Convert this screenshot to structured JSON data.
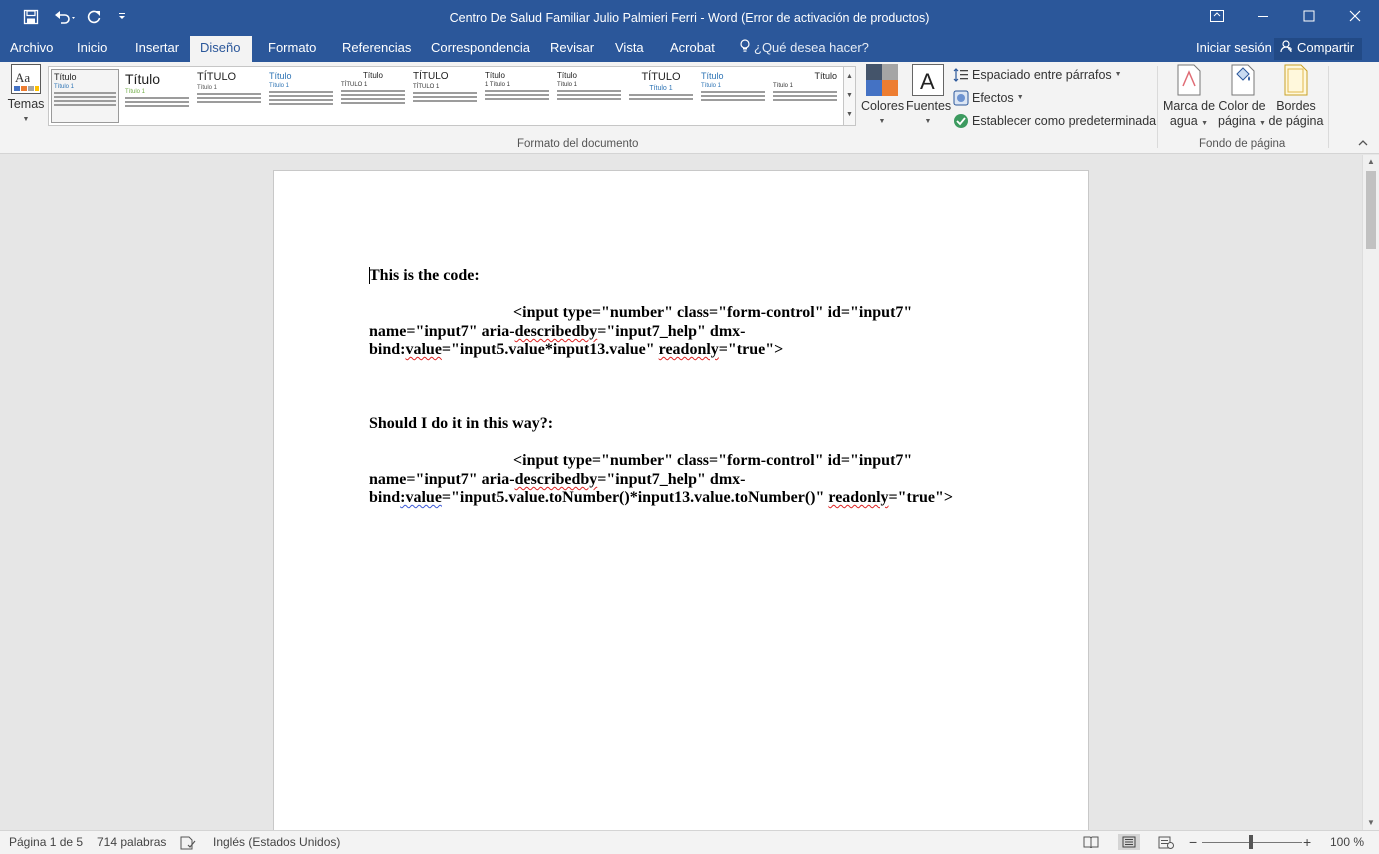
{
  "window": {
    "title": "Centro De Salud Familiar Julio Palmieri Ferri  -  Word (Error de activación de productos)"
  },
  "tabs": [
    {
      "label": "Archivo"
    },
    {
      "label": "Inicio"
    },
    {
      "label": "Insertar"
    },
    {
      "label": "Diseño"
    },
    {
      "label": "Formato"
    },
    {
      "label": "Referencias"
    },
    {
      "label": "Correspondencia"
    },
    {
      "label": "Revisar"
    },
    {
      "label": "Vista"
    },
    {
      "label": "Acrobat"
    }
  ],
  "active_tab": "Diseño",
  "tell_me": "¿Qué desea hacer?",
  "signin": "Iniciar sesión",
  "share": "Compartir",
  "ribbon": {
    "themes": "Temas",
    "styles": [
      {
        "title": "Título",
        "sub": "Título 1"
      },
      {
        "title": "Título",
        "sub": "Título 1"
      },
      {
        "title": "TÍTULO",
        "sub": "Título 1"
      },
      {
        "title": "Título",
        "sub": "Título 1"
      },
      {
        "title": "Título",
        "sub": "TÍTULO 1"
      },
      {
        "title": "TÍTULO",
        "sub": "TÍTULO 1"
      },
      {
        "title": "Título",
        "sub": "1   Título 1"
      },
      {
        "title": "Título",
        "sub": "Título 1"
      },
      {
        "title": "TÍTULO",
        "sub": "Título 1"
      },
      {
        "title": "Título",
        "sub": "Título 1"
      },
      {
        "title": "Título",
        "sub": "Título 1"
      }
    ],
    "colors": "Colores",
    "fonts": "Fuentes",
    "paragraph_spacing": "Espaciado entre párrafos",
    "effects": "Efectos",
    "set_default": "Establecer como predeterminada",
    "doc_format_group": "Formato del documento",
    "watermark_1": "Marca de",
    "watermark_2": "agua",
    "page_color_1": "Color de",
    "page_color_2": "página",
    "page_borders_1": "Bordes",
    "page_borders_2": "de página",
    "page_background_group": "Fondo de página"
  },
  "document": {
    "heading1": "This is the code:",
    "heading2": "Should I do it in this way?:",
    "code1": {
      "l1": "<input type=\"number\" class=\"form-control\" id=\"input7\"",
      "l2a": "name=\"input7\" aria-",
      "l2b": "describedby",
      "l2c": "=\"input7_help\" dmx-",
      "l3a": "bind:",
      "l3b": "value",
      "l3c": "=\"input5.value*input13.value\" ",
      "l3d": "readonly",
      "l3e": "=\"true\">"
    },
    "code2": {
      "l1": "<input type=\"number\" class=\"form-control\" id=\"input7\"",
      "l2a": "name=\"input7\" aria-",
      "l2b": "describedby",
      "l2c": "=\"input7_help\" dmx-",
      "l3a": "bind",
      "l3b": ":value",
      "l3c": "=\"input5.value.toNumber()*input13.value.toNumber()\" ",
      "l3d": "readonly",
      "l3e": "=\"true\">"
    }
  },
  "status": {
    "page": "Página 1 de 5",
    "words": "714 palabras",
    "language": "Inglés (Estados Unidos)",
    "zoom": "100 %"
  }
}
